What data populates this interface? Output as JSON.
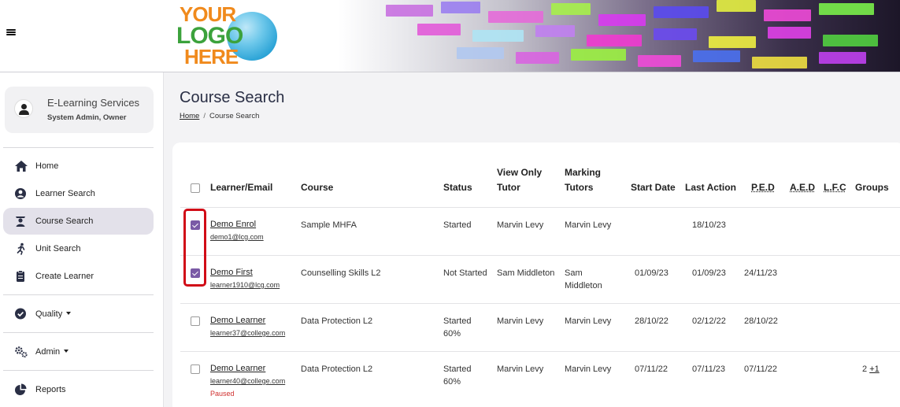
{
  "logo": {
    "line1": "YOUR",
    "line2": "LOGO",
    "line3": "HERE"
  },
  "colors": {
    "accent": "#7a5aa6",
    "highlight": "#d10c17",
    "paused": "#d0302f"
  },
  "profile": {
    "name": "E-Learning Services",
    "role": "System Admin, Owner"
  },
  "nav": {
    "home": "Home",
    "learner_search": "Learner Search",
    "course_search": "Course Search",
    "unit_search": "Unit Search",
    "create_learner": "Create Learner",
    "quality": "Quality",
    "admin": "Admin",
    "reports": "Reports"
  },
  "page": {
    "title": "Course Search"
  },
  "breadcrumb": {
    "home": "Home",
    "sep": "/",
    "current": "Course Search"
  },
  "table": {
    "headers": {
      "learner": "Learner/Email",
      "course": "Course",
      "status": "Status",
      "view_only_1": "View Only",
      "view_only_2": "Tutor",
      "marking_1": "Marking",
      "marking_2": "Tutors",
      "start_date": "Start Date",
      "last_action": "Last Action",
      "ped": "P.E.D",
      "aed": "A.E.D",
      "lfc": "L.F.C",
      "groups": "Groups"
    },
    "rows": [
      {
        "checked": true,
        "name": "Demo Enrol",
        "email": "demo1@lcg.com",
        "course": "Sample MHFA",
        "status": "Started",
        "progress": "",
        "view_tutor": "Marvin Levy",
        "marking_1": "Marvin Levy",
        "marking_2": "",
        "start": "",
        "last_action": "18/10/23",
        "ped": "",
        "note": "",
        "groups": "",
        "groups_more": ""
      },
      {
        "checked": true,
        "name": "Demo First",
        "email": "learner1910@lcg.com",
        "course": "Counselling Skills L2",
        "status": "Not Started",
        "progress": "",
        "view_tutor": "Sam Middleton",
        "marking_1": "Sam",
        "marking_2": "Middleton",
        "start": "01/09/23",
        "last_action": "01/09/23",
        "ped": "24/11/23",
        "note": "",
        "groups": "",
        "groups_more": ""
      },
      {
        "checked": false,
        "name": "Demo Learner",
        "email": "learner37@college.com",
        "course": "Data Protection L2",
        "status": "Started",
        "progress": "60%",
        "view_tutor": "Marvin Levy",
        "marking_1": "Marvin Levy",
        "marking_2": "",
        "start": "28/10/22",
        "last_action": "02/12/22",
        "ped": "28/10/22",
        "note": "",
        "groups": "",
        "groups_more": ""
      },
      {
        "checked": false,
        "name": "Demo Learner",
        "email": "learner40@college.com",
        "course": "Data Protection L2",
        "status": "Started",
        "progress": "60%",
        "view_tutor": "Marvin Levy",
        "marking_1": "Marvin Levy",
        "marking_2": "",
        "start": "07/11/22",
        "last_action": "07/11/23",
        "ped": "07/11/22",
        "note": "Paused",
        "groups": "2",
        "groups_more": "+1"
      }
    ]
  }
}
